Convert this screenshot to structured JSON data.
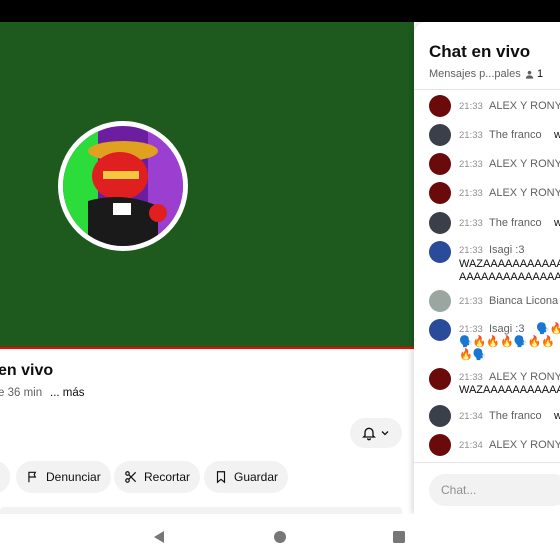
{
  "video": {
    "title": "en vivo",
    "meta": "e 36 min",
    "more": "... más"
  },
  "actions": {
    "report": "Denunciar",
    "clip": "Recortar",
    "save": "Guardar"
  },
  "chat": {
    "title": "Chat en vivo",
    "mode": "Mensajes p...pales",
    "viewers": "1",
    "input_placeholder": "Chat...",
    "messages": [
      {
        "time": "21:33",
        "author": "ALEX Y RONY",
        "text": ""
      },
      {
        "time": "21:33",
        "author": "The franco",
        "text": "w"
      },
      {
        "time": "21:33",
        "author": "ALEX Y RONY",
        "text": ""
      },
      {
        "time": "21:33",
        "author": "ALEX Y RONY",
        "text": ""
      },
      {
        "time": "21:33",
        "author": "The franco",
        "text": "w"
      },
      {
        "time": "21:33",
        "author": "Isagi :3",
        "line2": "WAZAAAAAAAAAAAA",
        "line3": "AAAAAAAAAAAAAAA"
      },
      {
        "time": "21:33",
        "author": "Bianca Licona",
        "text": ""
      },
      {
        "time": "21:33",
        "author": "Isagi :3",
        "emoji_line1": "🗣️🔥",
        "emoji_line2": "🗣️🔥🔥🔥🗣️🔥🔥",
        "emoji_line3": "🔥🗣️"
      },
      {
        "time": "21:33",
        "author": "ALEX Y RONY",
        "line2": "WAZAAAAAAAAAAAA"
      },
      {
        "time": "21:34",
        "author": "The franco",
        "text": "w"
      },
      {
        "time": "21:34",
        "author": "ALEX Y RONY",
        "text": ""
      }
    ]
  },
  "colors": {
    "video_bg": "#1e5a1e",
    "progress": "#ff0000"
  }
}
